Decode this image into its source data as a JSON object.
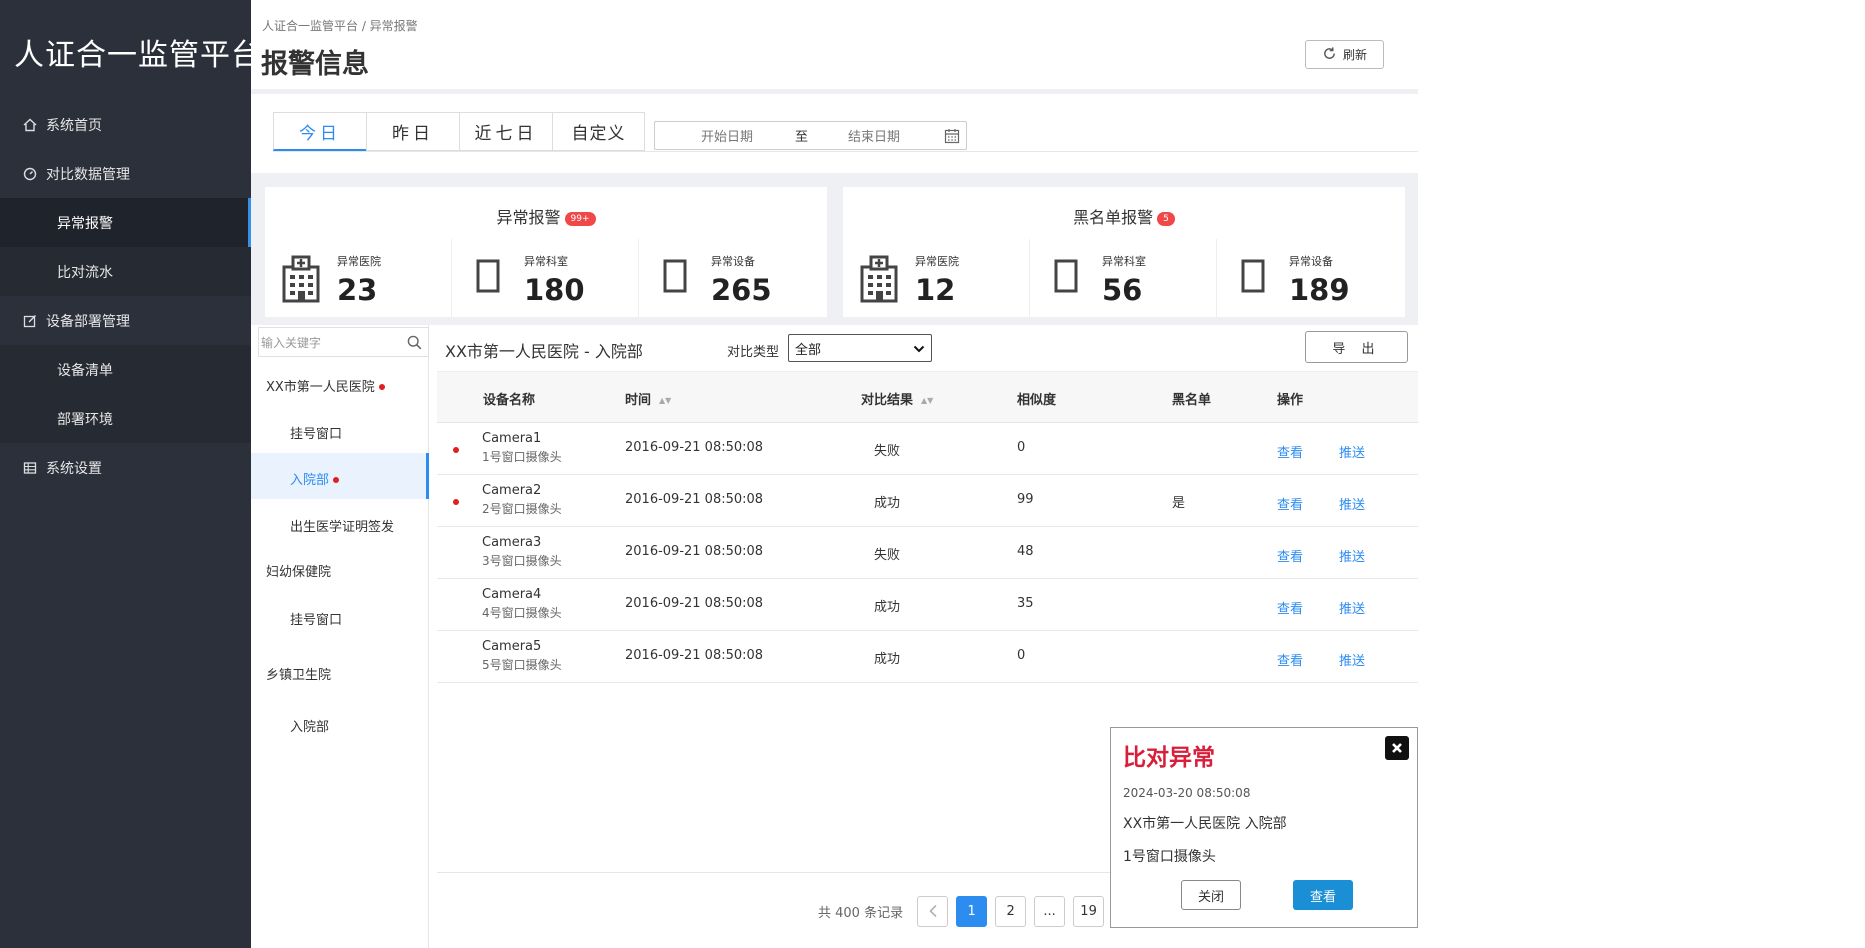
{
  "app": {
    "title": "人证合一监管平台"
  },
  "sidebar": {
    "items": [
      {
        "label": "系统首页",
        "icon": "home-icon"
      },
      {
        "label": "对比数据管理",
        "icon": "dashboard-icon"
      },
      {
        "label": "异常报警",
        "active": true
      },
      {
        "label": "比对流水"
      },
      {
        "label": "设备部署管理",
        "icon": "edit-icon"
      },
      {
        "label": "设备清单"
      },
      {
        "label": "部署环境"
      },
      {
        "label": "系统设置",
        "icon": "grid-icon"
      }
    ]
  },
  "header": {
    "breadcrumb": "人证合一监管平台 / 异常报警",
    "title": "报警信息",
    "refresh_label": "刷新"
  },
  "date_filter": {
    "tabs": [
      "今日",
      "昨日",
      "近七日",
      "自定义"
    ],
    "active_tab": "今日",
    "start_placeholder": "开始日期",
    "separator": "至",
    "end_placeholder": "结束日期"
  },
  "stats": {
    "abnormal": {
      "title": "异常报警",
      "badge": "99+",
      "items": [
        {
          "label": "异常医院",
          "value": "23"
        },
        {
          "label": "异常科室",
          "value": "180"
        },
        {
          "label": "异常设备",
          "value": "265"
        }
      ]
    },
    "blacklist": {
      "title": "黑名单报警",
      "badge": "5",
      "items": [
        {
          "label": "异常医院",
          "value": "12"
        },
        {
          "label": "异常科室",
          "value": "56"
        },
        {
          "label": "异常设备",
          "value": "189"
        }
      ]
    }
  },
  "tree": {
    "search_placeholder": "输入关键字",
    "nodes": [
      {
        "label": "XX市第一人民医院",
        "level": 0,
        "dot": true
      },
      {
        "label": "挂号窗口",
        "level": 1
      },
      {
        "label": "入院部",
        "level": 1,
        "dot": true,
        "active": true
      },
      {
        "label": "出生医学证明签发",
        "level": 1
      },
      {
        "label": "妇幼保健院",
        "level": 0
      },
      {
        "label": "挂号窗口",
        "level": 1
      },
      {
        "label": "乡镇卫生院",
        "level": 0
      },
      {
        "label": "入院部",
        "level": 1
      }
    ]
  },
  "table": {
    "title": "XX市第一人民医院 - 入院部",
    "filter_label": "对比类型",
    "filter_value": "全部",
    "export_label": "导 出",
    "columns": [
      "设备名称",
      "时间",
      "对比结果",
      "相似度",
      "黑名单",
      "操作"
    ],
    "rows": [
      {
        "dot": true,
        "name": "Camera1",
        "sub": "1号窗口摄像头",
        "time": "2016-09-21  08:50:08",
        "result": "失败",
        "similarity": "0",
        "blacklist": "",
        "view": "查看",
        "push": "推送"
      },
      {
        "dot": true,
        "name": "Camera2",
        "sub": "2号窗口摄像头",
        "time": "2016-09-21  08:50:08",
        "result": "成功",
        "similarity": "99",
        "blacklist": "是",
        "view": "查看",
        "push": "推送"
      },
      {
        "dot": false,
        "name": "Camera3",
        "sub": "3号窗口摄像头",
        "time": "2016-09-21  08:50:08",
        "result": "失败",
        "similarity": "48",
        "blacklist": "",
        "view": "查看",
        "push": "推送"
      },
      {
        "dot": false,
        "name": "Camera4",
        "sub": "4号窗口摄像头",
        "time": "2016-09-21  08:50:08",
        "result": "成功",
        "similarity": "35",
        "blacklist": "",
        "view": "查看",
        "push": "推送"
      },
      {
        "dot": false,
        "name": "Camera5",
        "sub": "5号窗口摄像头",
        "time": "2016-09-21  08:50:08",
        "result": "成功",
        "similarity": "0",
        "blacklist": "",
        "view": "查看",
        "push": "推送"
      }
    ]
  },
  "pagination": {
    "total_text": "共 400 条记录",
    "pages": [
      "1",
      "2",
      "...",
      "19"
    ],
    "current": "1"
  },
  "popup": {
    "title": "比对异常",
    "time": "2024-03-20  08:50:08",
    "location": "XX市第一人民医院    入院部",
    "camera": "1号窗口摄像头",
    "close_label": "关闭",
    "view_label": "查看"
  },
  "colors": {
    "sidebar_bg": "#2b303b",
    "accent": "#2d8cf0",
    "alert_red": "#d81e3a",
    "badge_red": "#f04848"
  }
}
